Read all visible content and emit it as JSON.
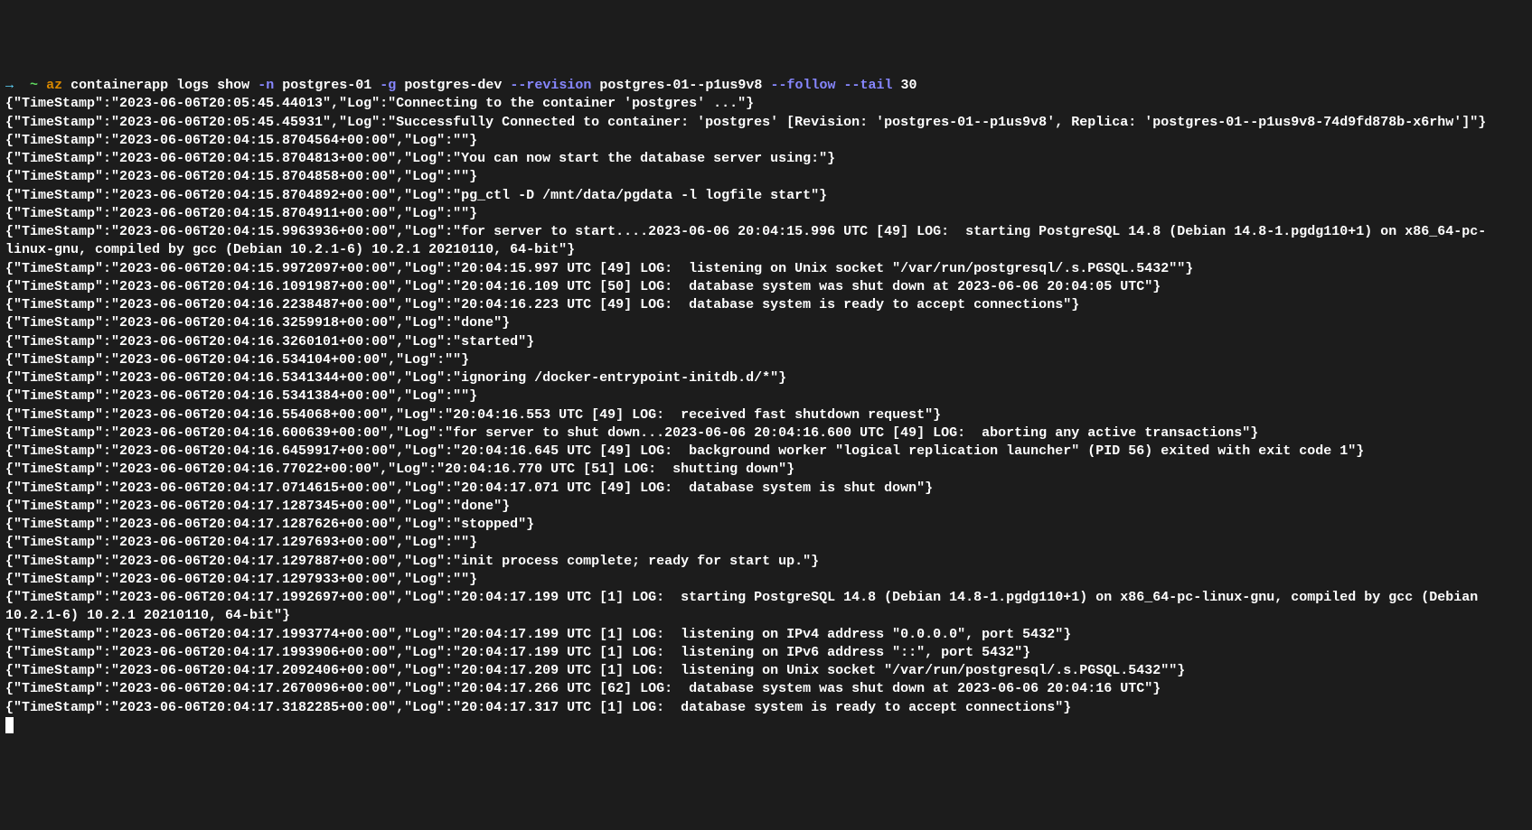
{
  "command": {
    "arrow": "→",
    "tilde": "~",
    "base": "az",
    "sub1": "containerapp",
    "sub2": "logs",
    "sub3": "show",
    "flag_n": "-n",
    "val_n": "postgres-01",
    "flag_g": "-g",
    "val_g": "postgres-dev",
    "flag_rev": "--revision",
    "val_rev": "postgres-01--p1us9v8",
    "flag_follow": "--follow",
    "flag_tail": "--tail",
    "val_tail": "30"
  },
  "logs": [
    "{\"TimeStamp\":\"2023-06-06T20:05:45.44013\",\"Log\":\"Connecting to the container 'postgres' ...\"}",
    "{\"TimeStamp\":\"2023-06-06T20:05:45.45931\",\"Log\":\"Successfully Connected to container: 'postgres' [Revision: 'postgres-01--p1us9v8', Replica: 'postgres-01--p1us9v8-74d9fd878b-x6rhw']\"}",
    "{\"TimeStamp\":\"2023-06-06T20:04:15.8704564+00:00\",\"Log\":\"\"}",
    "{\"TimeStamp\":\"2023-06-06T20:04:15.8704813+00:00\",\"Log\":\"You can now start the database server using:\"}",
    "{\"TimeStamp\":\"2023-06-06T20:04:15.8704858+00:00\",\"Log\":\"\"}",
    "{\"TimeStamp\":\"2023-06-06T20:04:15.8704892+00:00\",\"Log\":\"pg_ctl -D /mnt/data/pgdata -l logfile start\"}",
    "{\"TimeStamp\":\"2023-06-06T20:04:15.8704911+00:00\",\"Log\":\"\"}",
    "{\"TimeStamp\":\"2023-06-06T20:04:15.9963936+00:00\",\"Log\":\"for server to start....2023-06-06 20:04:15.996 UTC [49] LOG:  starting PostgreSQL 14.8 (Debian 14.8-1.pgdg110+1) on x86_64-pc-linux-gnu, compiled by gcc (Debian 10.2.1-6) 10.2.1 20210110, 64-bit\"}",
    "{\"TimeStamp\":\"2023-06-06T20:04:15.9972097+00:00\",\"Log\":\"20:04:15.997 UTC [49] LOG:  listening on Unix socket \"/var/run/postgresql/.s.PGSQL.5432\"\"}",
    "{\"TimeStamp\":\"2023-06-06T20:04:16.1091987+00:00\",\"Log\":\"20:04:16.109 UTC [50] LOG:  database system was shut down at 2023-06-06 20:04:05 UTC\"}",
    "{\"TimeStamp\":\"2023-06-06T20:04:16.2238487+00:00\",\"Log\":\"20:04:16.223 UTC [49] LOG:  database system is ready to accept connections\"}",
    "{\"TimeStamp\":\"2023-06-06T20:04:16.3259918+00:00\",\"Log\":\"done\"}",
    "{\"TimeStamp\":\"2023-06-06T20:04:16.3260101+00:00\",\"Log\":\"started\"}",
    "{\"TimeStamp\":\"2023-06-06T20:04:16.534104+00:00\",\"Log\":\"\"}",
    "{\"TimeStamp\":\"2023-06-06T20:04:16.5341344+00:00\",\"Log\":\"ignoring /docker-entrypoint-initdb.d/*\"}",
    "{\"TimeStamp\":\"2023-06-06T20:04:16.5341384+00:00\",\"Log\":\"\"}",
    "{\"TimeStamp\":\"2023-06-06T20:04:16.554068+00:00\",\"Log\":\"20:04:16.553 UTC [49] LOG:  received fast shutdown request\"}",
    "{\"TimeStamp\":\"2023-06-06T20:04:16.600639+00:00\",\"Log\":\"for server to shut down...2023-06-06 20:04:16.600 UTC [49] LOG:  aborting any active transactions\"}",
    "{\"TimeStamp\":\"2023-06-06T20:04:16.6459917+00:00\",\"Log\":\"20:04:16.645 UTC [49] LOG:  background worker \"logical replication launcher\" (PID 56) exited with exit code 1\"}",
    "{\"TimeStamp\":\"2023-06-06T20:04:16.77022+00:00\",\"Log\":\"20:04:16.770 UTC [51] LOG:  shutting down\"}",
    "{\"TimeStamp\":\"2023-06-06T20:04:17.0714615+00:00\",\"Log\":\"20:04:17.071 UTC [49] LOG:  database system is shut down\"}",
    "{\"TimeStamp\":\"2023-06-06T20:04:17.1287345+00:00\",\"Log\":\"done\"}",
    "{\"TimeStamp\":\"2023-06-06T20:04:17.1287626+00:00\",\"Log\":\"stopped\"}",
    "{\"TimeStamp\":\"2023-06-06T20:04:17.1297693+00:00\",\"Log\":\"\"}",
    "{\"TimeStamp\":\"2023-06-06T20:04:17.1297887+00:00\",\"Log\":\"init process complete; ready for start up.\"}",
    "{\"TimeStamp\":\"2023-06-06T20:04:17.1297933+00:00\",\"Log\":\"\"}",
    "{\"TimeStamp\":\"2023-06-06T20:04:17.1992697+00:00\",\"Log\":\"20:04:17.199 UTC [1] LOG:  starting PostgreSQL 14.8 (Debian 14.8-1.pgdg110+1) on x86_64-pc-linux-gnu, compiled by gcc (Debian 10.2.1-6) 10.2.1 20210110, 64-bit\"}",
    "{\"TimeStamp\":\"2023-06-06T20:04:17.1993774+00:00\",\"Log\":\"20:04:17.199 UTC [1] LOG:  listening on IPv4 address \"0.0.0.0\", port 5432\"}",
    "{\"TimeStamp\":\"2023-06-06T20:04:17.1993906+00:00\",\"Log\":\"20:04:17.199 UTC [1] LOG:  listening on IPv6 address \"::\", port 5432\"}",
    "{\"TimeStamp\":\"2023-06-06T20:04:17.2092406+00:00\",\"Log\":\"20:04:17.209 UTC [1] LOG:  listening on Unix socket \"/var/run/postgresql/.s.PGSQL.5432\"\"}",
    "{\"TimeStamp\":\"2023-06-06T20:04:17.2670096+00:00\",\"Log\":\"20:04:17.266 UTC [62] LOG:  database system was shut down at 2023-06-06 20:04:16 UTC\"}",
    "{\"TimeStamp\":\"2023-06-06T20:04:17.3182285+00:00\",\"Log\":\"20:04:17.317 UTC [1] LOG:  database system is ready to accept connections\"}"
  ]
}
